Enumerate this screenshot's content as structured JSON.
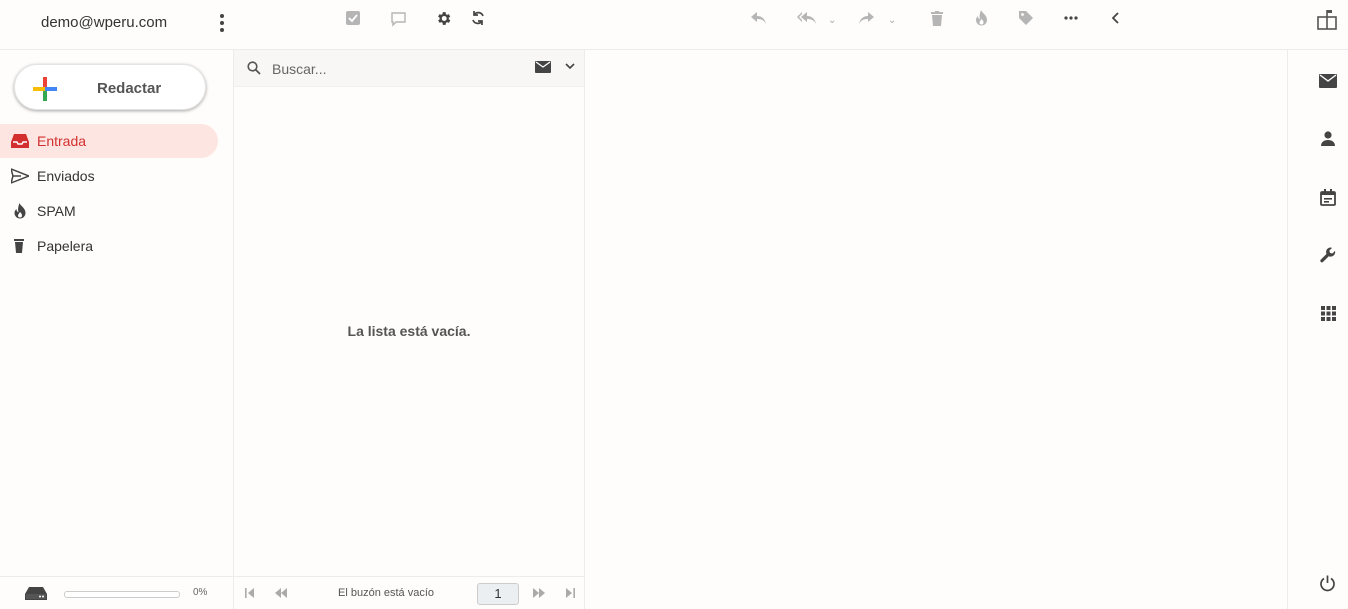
{
  "header": {
    "account_email": "demo@wperu.com"
  },
  "compose": {
    "label": "Redactar"
  },
  "folders": [
    {
      "label": "Entrada",
      "icon": "inbox-icon",
      "active": true
    },
    {
      "label": "Enviados",
      "icon": "send-icon",
      "active": false
    },
    {
      "label": "SPAM",
      "icon": "fire-icon",
      "active": false
    },
    {
      "label": "Papelera",
      "icon": "trash-icon",
      "active": false
    }
  ],
  "quota": {
    "percent_label": "0%",
    "fraction": 0
  },
  "search": {
    "placeholder": "Buscar...",
    "value": ""
  },
  "message_list": {
    "empty_text": "La lista está vacía.",
    "status_text": "El buzón está vacío",
    "page": "1"
  },
  "colors": {
    "accent": "#d32f2f",
    "active_bg": "#fde6e2",
    "icon_dark": "#444444",
    "icon_light": "#b0b0b0"
  }
}
